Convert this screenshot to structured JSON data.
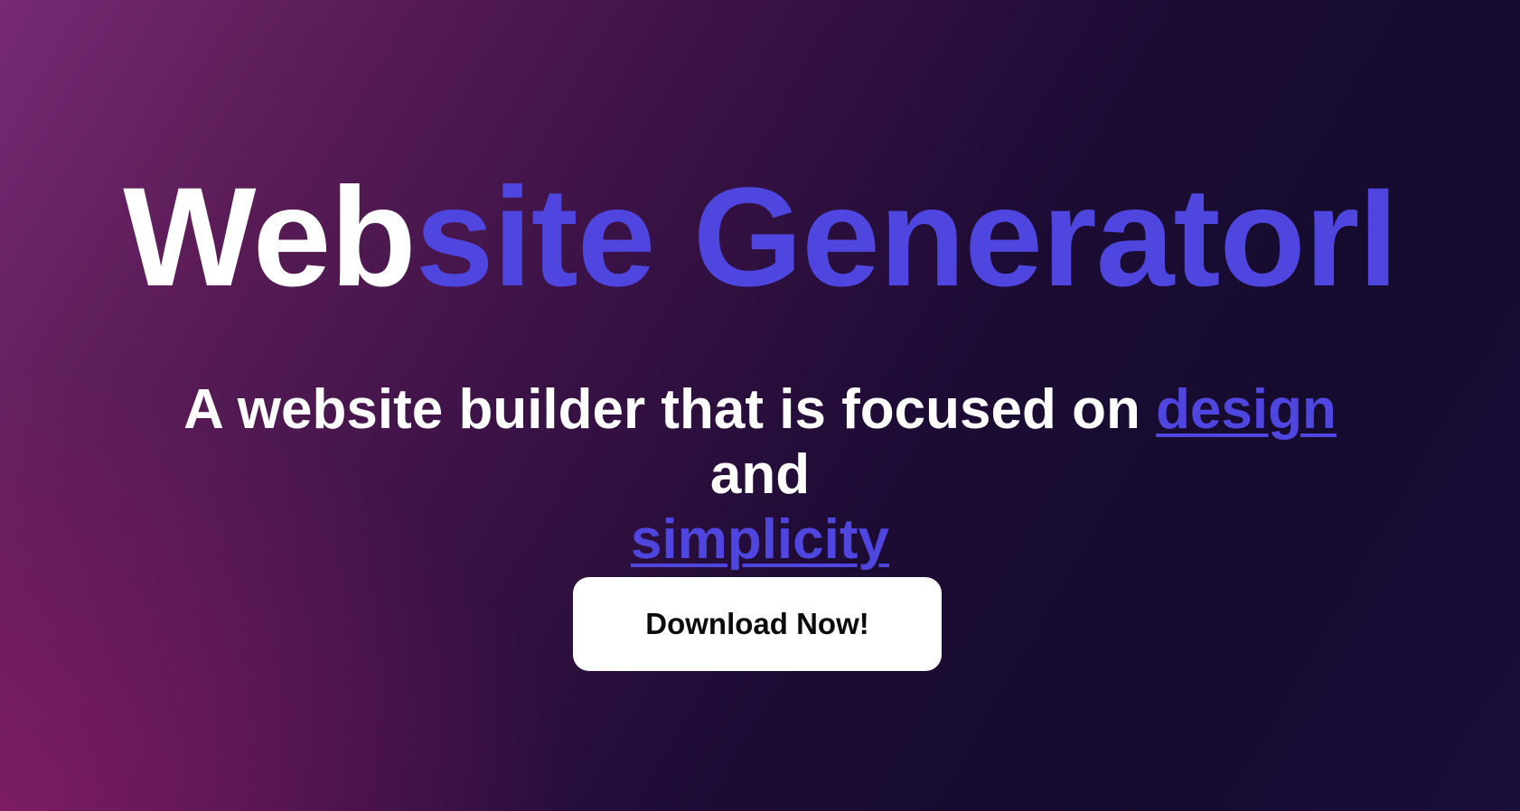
{
  "hero": {
    "title_part1": "Web",
    "title_part2": "site GeneratorI",
    "subtitle_prefix": "A website builder that is focused on ",
    "subtitle_link1": "design",
    "subtitle_middle": " and ",
    "subtitle_link2": "simplicity",
    "button_label": "Download Now!"
  },
  "colors": {
    "accent": "#4f46e0",
    "background_dark": "#150b2e",
    "background_magenta": "#8a2068",
    "text_primary": "#ffffff",
    "button_bg": "#ffffff",
    "button_text": "#0b0b0b"
  }
}
